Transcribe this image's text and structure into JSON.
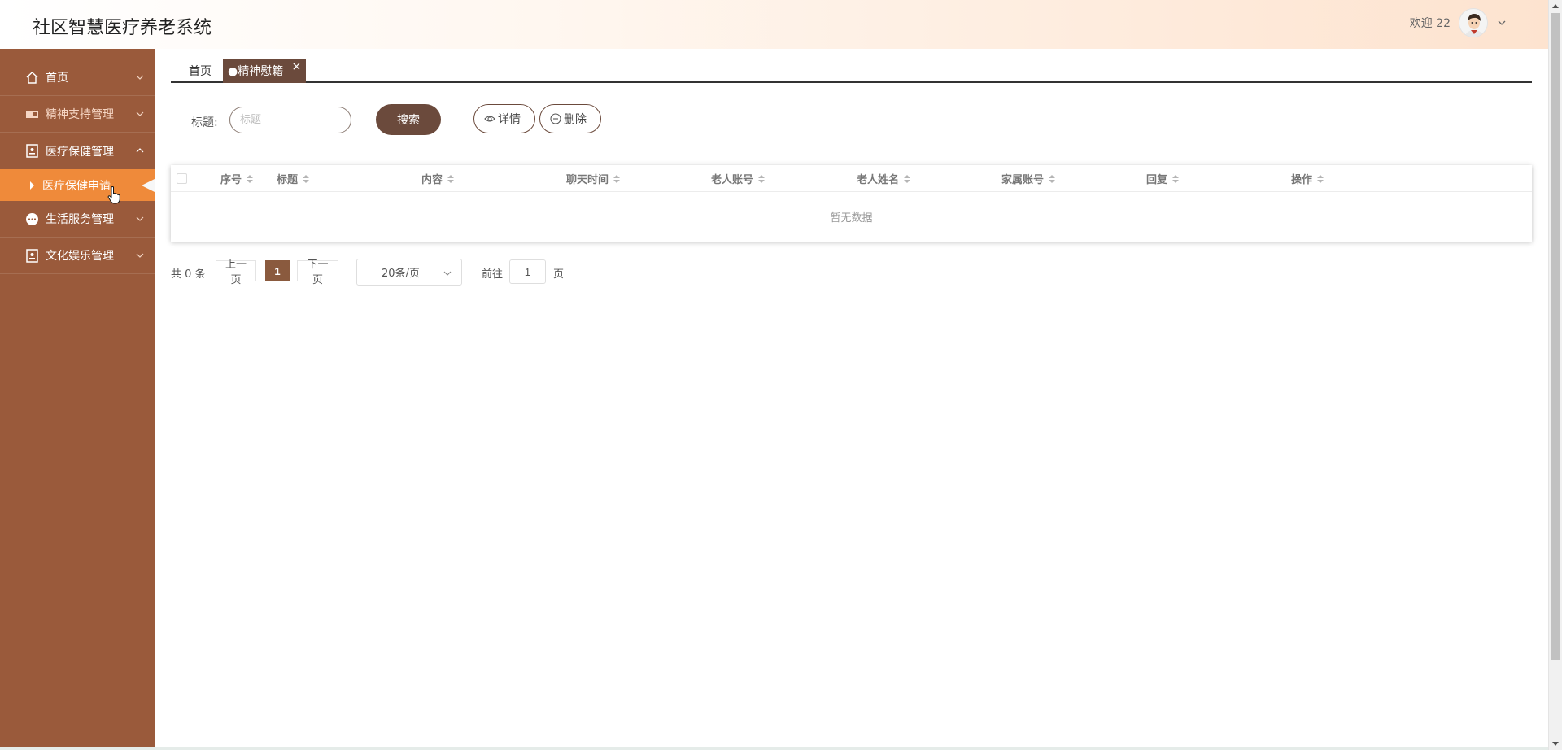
{
  "header": {
    "title": "社区智慧医疗养老系统",
    "welcome": "欢迎 22"
  },
  "sidebar": {
    "items": [
      {
        "label": "首页",
        "icon": "home-icon"
      },
      {
        "label": "精神支持管理",
        "icon": "ticket-icon"
      },
      {
        "label": "医疗保健管理",
        "icon": "badge-icon",
        "expanded": true
      },
      {
        "label": "生活服务管理",
        "icon": "chat-bubble-icon"
      },
      {
        "label": "文化娱乐管理",
        "icon": "badge-icon"
      }
    ],
    "submenu": {
      "label": "医疗保健申请"
    }
  },
  "tabs": {
    "home": "首页",
    "active": "●精神慰籍",
    "close": "×"
  },
  "search": {
    "label": "标题:",
    "placeholder": "标题",
    "search_button": "搜索",
    "detail_button": "详情",
    "delete_button": "删除"
  },
  "table": {
    "columns": [
      "序号",
      "标题",
      "内容",
      "聊天时间",
      "老人账号",
      "老人姓名",
      "家属账号",
      "回复",
      "操作"
    ],
    "empty_text": "暂无数据"
  },
  "pager": {
    "total": "共 0 条",
    "prev": "上一页",
    "current": "1",
    "next": "下一页",
    "page_size": "20条/页",
    "goto_label": "前往",
    "goto_value": "1",
    "unit": "页"
  },
  "colors": {
    "sidebar_bg": "#9a5a3b",
    "submenu_active": "#ef8a3a",
    "primary": "#6b4a3c",
    "pager_active": "#8a5a3e"
  }
}
